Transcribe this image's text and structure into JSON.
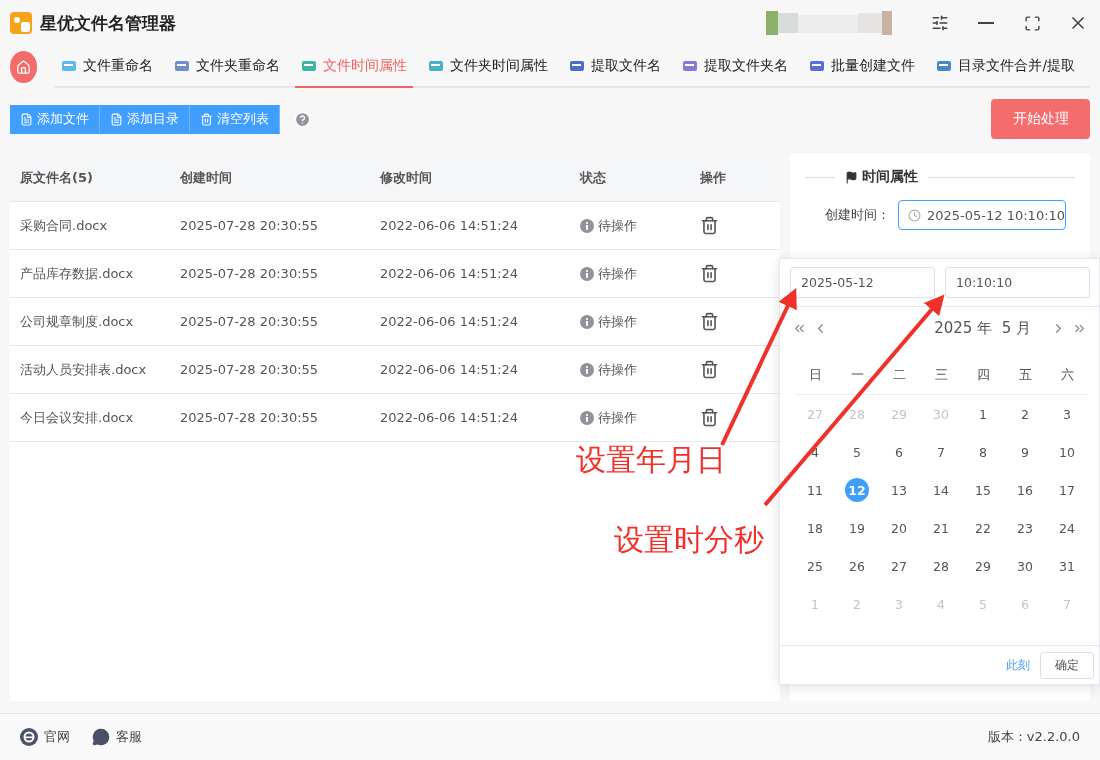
{
  "window": {
    "title": "星优文件名管理器"
  },
  "tabs": [
    {
      "label": "文件重命名",
      "selected": false
    },
    {
      "label": "文件夹重命名",
      "selected": false
    },
    {
      "label": "文件时间属性",
      "selected": true
    },
    {
      "label": "文件夹时间属性",
      "selected": false
    },
    {
      "label": "提取文件名",
      "selected": false
    },
    {
      "label": "提取文件夹名",
      "selected": false
    },
    {
      "label": "批量创建文件",
      "selected": false
    },
    {
      "label": "目录文件合并/提取",
      "selected": false
    }
  ],
  "toolbar": {
    "buttons": [
      {
        "label": "添加文件",
        "kind": "file"
      },
      {
        "label": "添加目录",
        "kind": "file"
      },
      {
        "label": "清空列表",
        "kind": "trash"
      }
    ],
    "start_button": "开始处理"
  },
  "table": {
    "columns": [
      "原文件名(5)",
      "创建时间",
      "修改时间",
      "状态",
      "操作"
    ],
    "rows": [
      {
        "name": "采购合同.docx",
        "created": "2025-07-28 20:30:55",
        "modified": "2022-06-06 14:51:24",
        "status": "待操作"
      },
      {
        "name": "产品库存数据.docx",
        "created": "2025-07-28 20:30:55",
        "modified": "2022-06-06 14:51:24",
        "status": "待操作"
      },
      {
        "name": "公司规章制度.docx",
        "created": "2025-07-28 20:30:55",
        "modified": "2022-06-06 14:51:24",
        "status": "待操作"
      },
      {
        "name": "活动人员安排表.docx",
        "created": "2025-07-28 20:30:55",
        "modified": "2022-06-06 14:51:24",
        "status": "待操作"
      },
      {
        "name": "今日会议安排.docx",
        "created": "2025-07-28 20:30:55",
        "modified": "2022-06-06 14:51:24",
        "status": "待操作"
      }
    ]
  },
  "panel": {
    "title": "时间属性",
    "created_label": "创建时间：",
    "created_value": "2025-05-12 10:10:10"
  },
  "date_picker": {
    "date_value": "2025-05-12",
    "time_value": "10:10:10",
    "header": "2025 年  5 月",
    "weekdays": [
      "日",
      "一",
      "二",
      "三",
      "四",
      "五",
      "六"
    ],
    "days": [
      {
        "label": "27",
        "kind": "other",
        "selected": false
      },
      {
        "label": "28",
        "kind": "other",
        "selected": false
      },
      {
        "label": "29",
        "kind": "other",
        "selected": false
      },
      {
        "label": "30",
        "kind": "other",
        "selected": false
      },
      {
        "label": "1",
        "kind": "current",
        "selected": false
      },
      {
        "label": "2",
        "kind": "current",
        "selected": false
      },
      {
        "label": "3",
        "kind": "current",
        "selected": false
      },
      {
        "label": "4",
        "kind": "current",
        "selected": false
      },
      {
        "label": "5",
        "kind": "current",
        "selected": false
      },
      {
        "label": "6",
        "kind": "current",
        "selected": false
      },
      {
        "label": "7",
        "kind": "current",
        "selected": false
      },
      {
        "label": "8",
        "kind": "current",
        "selected": false
      },
      {
        "label": "9",
        "kind": "current",
        "selected": false
      },
      {
        "label": "10",
        "kind": "current",
        "selected": false
      },
      {
        "label": "11",
        "kind": "current",
        "selected": false
      },
      {
        "label": "12",
        "kind": "current",
        "selected": true
      },
      {
        "label": "13",
        "kind": "current",
        "selected": false
      },
      {
        "label": "14",
        "kind": "current",
        "selected": false
      },
      {
        "label": "15",
        "kind": "current",
        "selected": false
      },
      {
        "label": "16",
        "kind": "current",
        "selected": false
      },
      {
        "label": "17",
        "kind": "current",
        "selected": false
      },
      {
        "label": "18",
        "kind": "current",
        "selected": false
      },
      {
        "label": "19",
        "kind": "current",
        "selected": false
      },
      {
        "label": "20",
        "kind": "current",
        "selected": false
      },
      {
        "label": "21",
        "kind": "current",
        "selected": false
      },
      {
        "label": "22",
        "kind": "current",
        "selected": false
      },
      {
        "label": "23",
        "kind": "current",
        "selected": false
      },
      {
        "label": "24",
        "kind": "current",
        "selected": false
      },
      {
        "label": "25",
        "kind": "current",
        "selected": false
      },
      {
        "label": "26",
        "kind": "current",
        "selected": false
      },
      {
        "label": "27",
        "kind": "current",
        "selected": false
      },
      {
        "label": "28",
        "kind": "current",
        "selected": false
      },
      {
        "label": "29",
        "kind": "current",
        "selected": false
      },
      {
        "label": "30",
        "kind": "current",
        "selected": false
      },
      {
        "label": "31",
        "kind": "current",
        "selected": false
      },
      {
        "label": "1",
        "kind": "other",
        "selected": false
      },
      {
        "label": "2",
        "kind": "other",
        "selected": false
      },
      {
        "label": "3",
        "kind": "other",
        "selected": false
      },
      {
        "label": "4",
        "kind": "other",
        "selected": false
      },
      {
        "label": "5",
        "kind": "other",
        "selected": false
      },
      {
        "label": "6",
        "kind": "other",
        "selected": false
      },
      {
        "label": "7",
        "kind": "other",
        "selected": false
      }
    ],
    "now_link": "此刻",
    "confirm_button": "确定"
  },
  "annotations": [
    "设置年月日",
    "设置时分秒"
  ],
  "footer": {
    "links": [
      {
        "label": "官网",
        "kind": "web"
      },
      {
        "label": "客服",
        "kind": "chat"
      }
    ],
    "version": "版本：v2.2.0.0"
  }
}
